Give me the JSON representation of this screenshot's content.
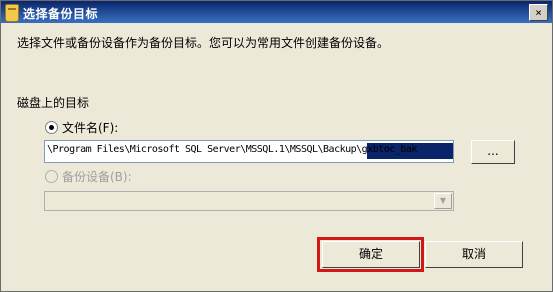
{
  "title": "选择备份目标",
  "close_glyph": "×",
  "instruction": "选择文件或备份设备作为备份目标。您可以为常用文件创建备份设备。",
  "section_label": "磁盘上的目标",
  "radio_file": {
    "label": "文件名(F):",
    "checked": true
  },
  "path_field": {
    "value": "\\Program Files\\Microsoft SQL Server\\MSSQL.1\\MSSQL\\Backup\\gxbtoc_bak"
  },
  "browse_button": "...",
  "radio_device": {
    "label": "备份设备(B):",
    "checked": false,
    "disabled": true
  },
  "device_select": {
    "value": ""
  },
  "ok_button": "确定",
  "cancel_button": "取消",
  "colors": {
    "title_bar": "#0a246a",
    "highlight_border": "#d01818",
    "selection": "#0a246a"
  }
}
